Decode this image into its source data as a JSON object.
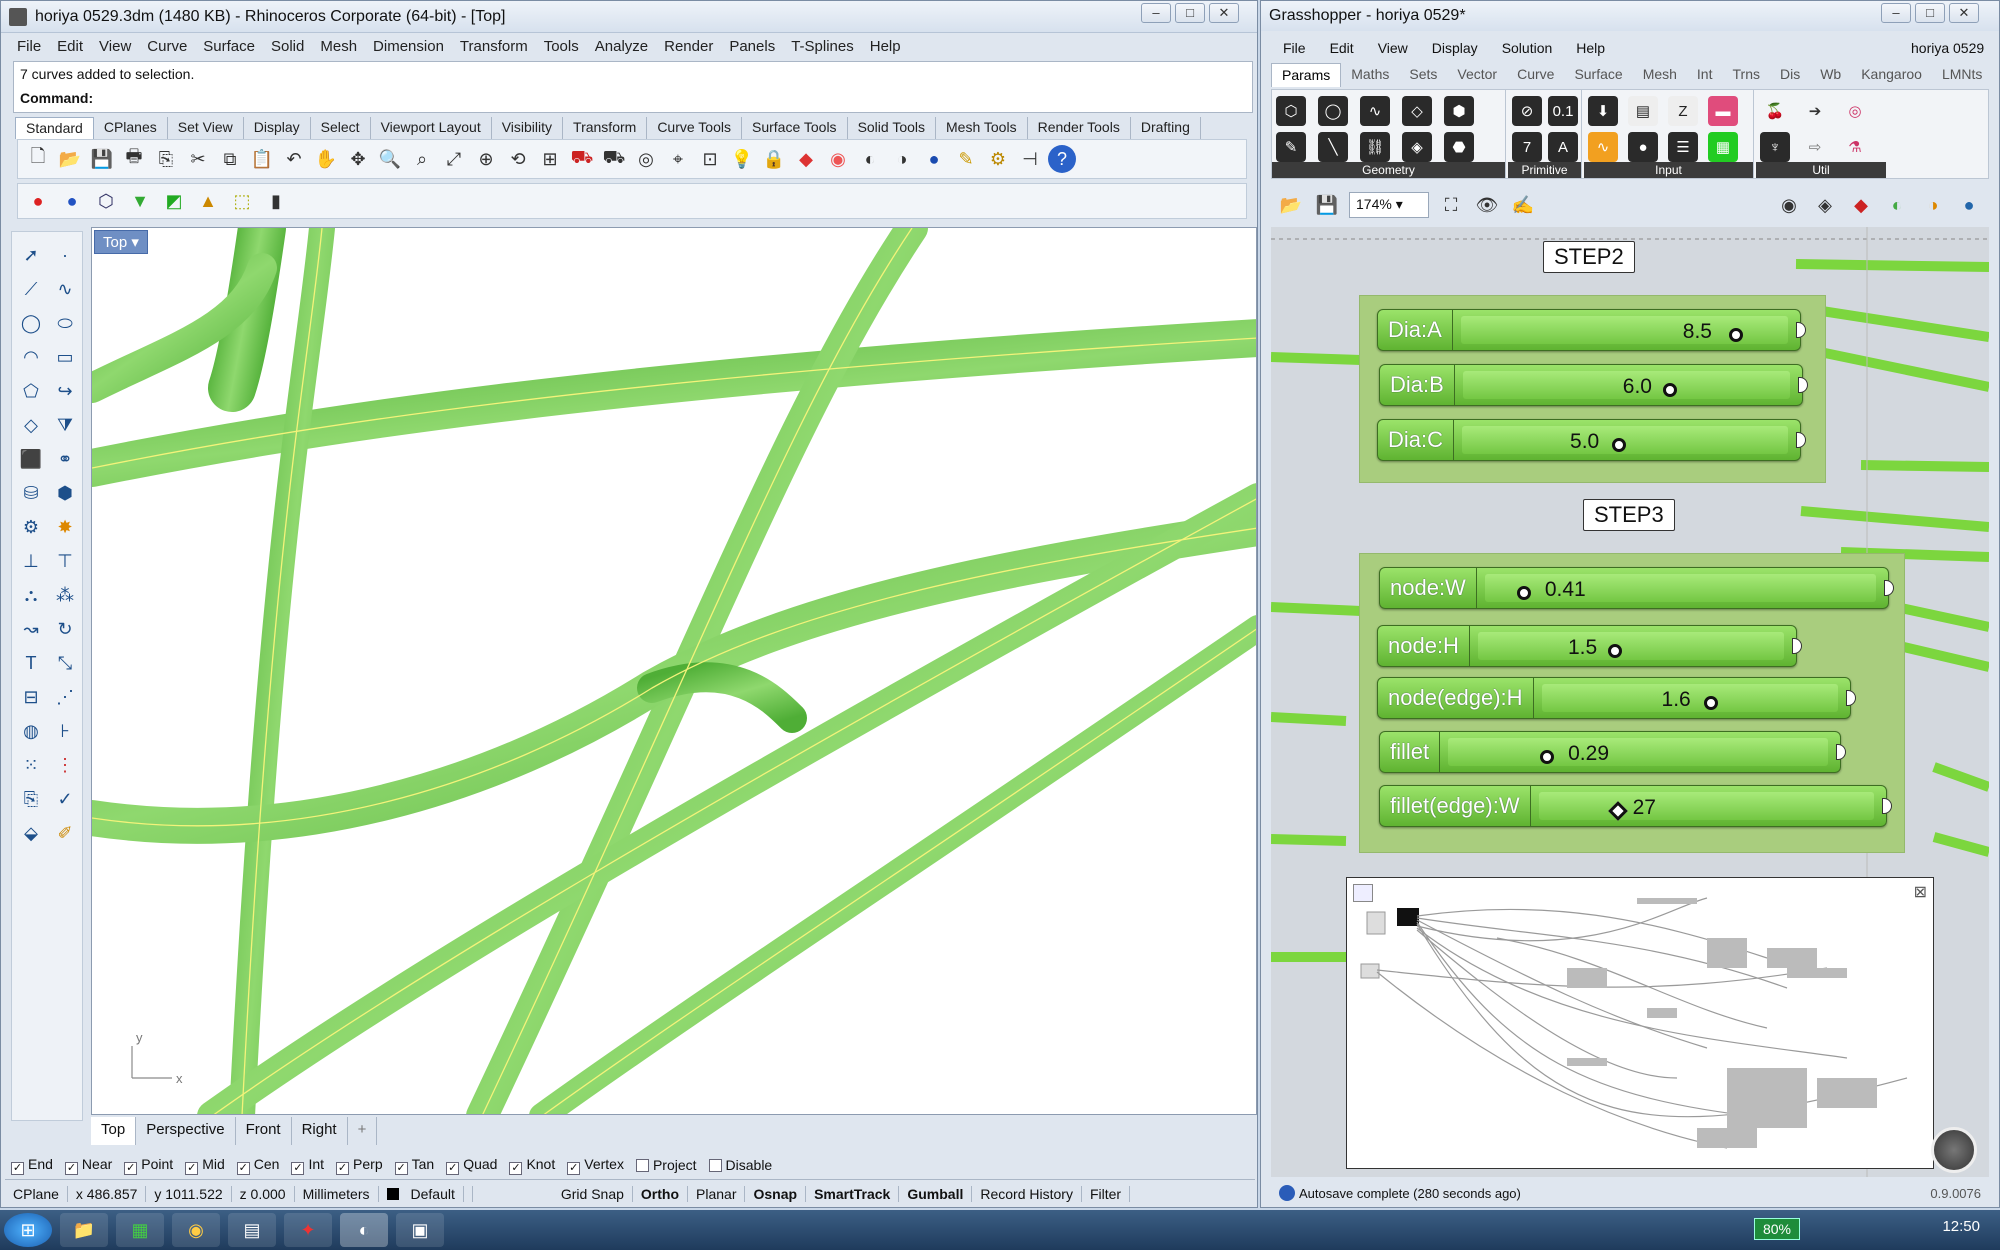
{
  "rhino": {
    "title": "horiya 0529.3dm (1480 KB) - Rhinoceros Corporate (64-bit) - [Top]",
    "menu": [
      "File",
      "Edit",
      "View",
      "Curve",
      "Surface",
      "Solid",
      "Mesh",
      "Dimension",
      "Transform",
      "Tools",
      "Analyze",
      "Render",
      "Panels",
      "T-Splines",
      "Help"
    ],
    "history_line": "7 curves added to selection.",
    "command_label": "Command:",
    "toolbar_tabs": [
      "Standard",
      "CPlanes",
      "Set View",
      "Display",
      "Select",
      "Viewport Layout",
      "Visibility",
      "Transform",
      "Curve Tools",
      "Surface Tools",
      "Solid Tools",
      "Mesh Tools",
      "Render Tools",
      "Drafting"
    ],
    "viewport_label": "Top",
    "axis_x": "x",
    "axis_y": "y",
    "viewport_tabs": [
      "Top",
      "Perspective",
      "Front",
      "Right"
    ],
    "osnaps": [
      {
        "label": "End",
        "checked": true
      },
      {
        "label": "Near",
        "checked": true
      },
      {
        "label": "Point",
        "checked": true
      },
      {
        "label": "Mid",
        "checked": true
      },
      {
        "label": "Cen",
        "checked": true
      },
      {
        "label": "Int",
        "checked": true
      },
      {
        "label": "Perp",
        "checked": true
      },
      {
        "label": "Tan",
        "checked": true
      },
      {
        "label": "Quad",
        "checked": true
      },
      {
        "label": "Knot",
        "checked": true
      },
      {
        "label": "Vertex",
        "checked": true
      },
      {
        "label": "Project",
        "checked": false
      },
      {
        "label": "Disable",
        "checked": false
      }
    ],
    "status": {
      "cplane": "CPlane",
      "x": "x 486.857",
      "y": "y 1011.522",
      "z": "z 0.000",
      "units": "Millimeters",
      "layer": "Default",
      "grid_snap": "Grid Snap",
      "ortho": "Ortho",
      "planar": "Planar",
      "osnap": "Osnap",
      "smarttrack": "SmartTrack",
      "gumball": "Gumball",
      "record_history": "Record History",
      "filter": "Filter"
    }
  },
  "grasshopper": {
    "title": "Grasshopper - horiya 0529*",
    "menu": [
      "File",
      "Edit",
      "View",
      "Display",
      "Solution",
      "Help"
    ],
    "doc_name": "horiya 0529",
    "tabs": [
      "Params",
      "Maths",
      "Sets",
      "Vector",
      "Curve",
      "Surface",
      "Mesh",
      "Int",
      "Trns",
      "Dis",
      "Wb",
      "Kangaroo",
      "LMNts"
    ],
    "ribbon_groups": [
      "Geometry",
      "Primitive",
      "Input",
      "Util"
    ],
    "zoom": "174%",
    "step2_label": "STEP2",
    "step3_label": "STEP3",
    "sliders": [
      {
        "name": "Dia:A",
        "value": "8.5",
        "fraction": 0.84
      },
      {
        "name": "Dia:B",
        "value": "6.0",
        "fraction": 0.59
      },
      {
        "name": "Dia:C",
        "value": "5.0",
        "fraction": 0.49
      },
      {
        "name": "node:W",
        "value": "0.41",
        "fraction": 0.13
      },
      {
        "name": "node:H",
        "value": "1.5",
        "fraction": 0.5
      },
      {
        "name": "node(edge):H",
        "value": "1.6",
        "fraction": 0.6
      },
      {
        "name": "fillet",
        "value": "0.29",
        "fraction": 0.32
      },
      {
        "name": "fillet(edge):W",
        "value": "27",
        "fraction": 0.3
      }
    ],
    "status_text": "Autosave complete (280 seconds ago)",
    "version": "0.9.0076"
  },
  "taskbar": {
    "battery": "80%",
    "clock": "12:50"
  },
  "colors": {
    "surface_green": "#66c04a",
    "slider_green": "#7bcf4a",
    "group_green": "#a9cd7e"
  }
}
